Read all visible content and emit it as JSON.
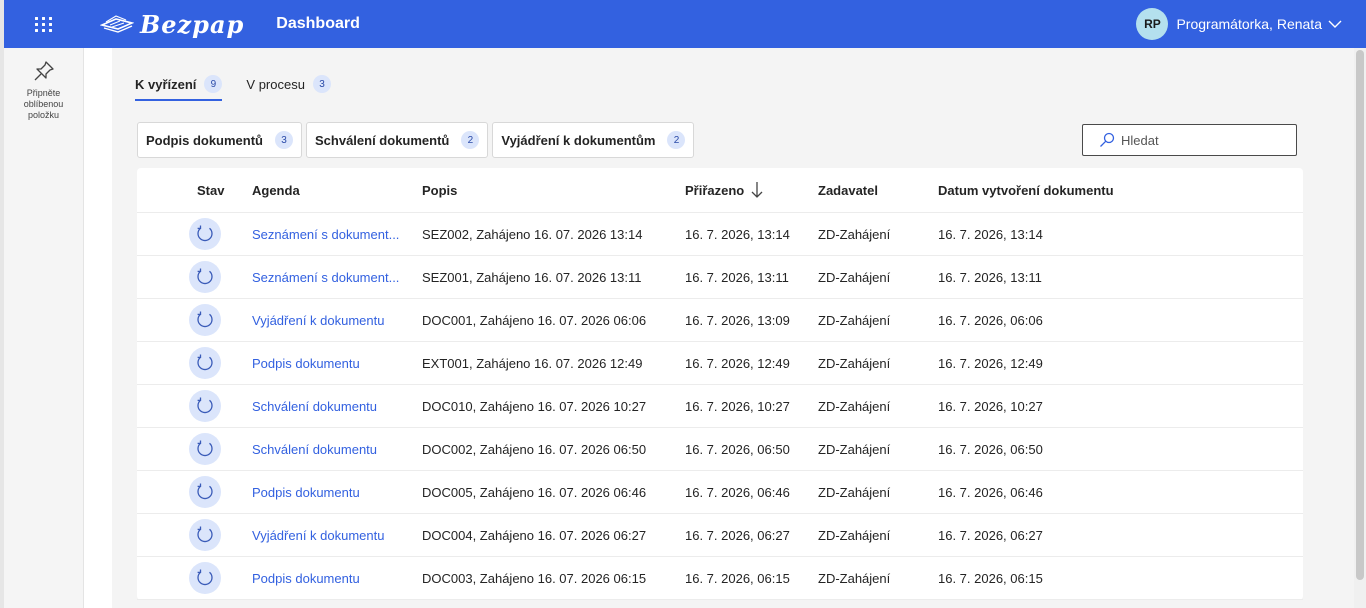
{
  "header": {
    "logo_text": "Bezpap",
    "title": "Dashboard",
    "user": {
      "initials": "RP",
      "name": "Programátorka, Renata"
    },
    "brand_color": "#3361e0"
  },
  "sidebar": {
    "pin_label": "Připněte oblíbenou položku"
  },
  "tabs": [
    {
      "label": "K vyřízení",
      "count": "9",
      "active": true
    },
    {
      "label": "V procesu",
      "count": "3",
      "active": false
    }
  ],
  "filters": [
    {
      "label": "Podpis dokumentů",
      "count": "3"
    },
    {
      "label": "Schválení dokumentů",
      "count": "2"
    },
    {
      "label": "Vyjádření k dokumentům",
      "count": "2"
    }
  ],
  "search": {
    "placeholder": "Hledat"
  },
  "table": {
    "headers": {
      "stav": "Stav",
      "agenda": "Agenda",
      "popis": "Popis",
      "prirazeno": "Přiřazeno",
      "zadavatel": "Zadavatel",
      "datum": "Datum vytvoření dokumentu"
    },
    "sort": {
      "column": "prirazeno",
      "direction": "descending"
    },
    "rows": [
      {
        "agenda": "Seznámení s dokument...",
        "popis": "SEZ002, Zahájeno 16. 07. 2026 13:14",
        "prirazeno": "16. 7. 2026, 13:14",
        "zadavatel": "ZD-Zahájení",
        "datum": "16. 7. 2026, 13:14"
      },
      {
        "agenda": "Seznámení s dokument...",
        "popis": "SEZ001, Zahájeno 16. 07. 2026 13:11",
        "prirazeno": "16. 7. 2026, 13:11",
        "zadavatel": "ZD-Zahájení",
        "datum": "16. 7. 2026, 13:11"
      },
      {
        "agenda": "Vyjádření k dokumentu",
        "popis": "DOC001, Zahájeno 16. 07. 2026 06:06",
        "prirazeno": "16. 7. 2026, 13:09",
        "zadavatel": "ZD-Zahájení",
        "datum": "16. 7. 2026, 06:06"
      },
      {
        "agenda": "Podpis dokumentu",
        "popis": "EXT001, Zahájeno 16. 07. 2026 12:49",
        "prirazeno": "16. 7. 2026, 12:49",
        "zadavatel": "ZD-Zahájení",
        "datum": "16. 7. 2026, 12:49"
      },
      {
        "agenda": "Schválení dokumentu",
        "popis": "DOC010, Zahájeno 16. 07. 2026 10:27",
        "prirazeno": "16. 7. 2026, 10:27",
        "zadavatel": "ZD-Zahájení",
        "datum": "16. 7. 2026, 10:27"
      },
      {
        "agenda": "Schválení dokumentu",
        "popis": "DOC002, Zahájeno 16. 07. 2026 06:50",
        "prirazeno": "16. 7. 2026, 06:50",
        "zadavatel": "ZD-Zahájení",
        "datum": "16. 7. 2026, 06:50"
      },
      {
        "agenda": "Podpis dokumentu",
        "popis": "DOC005, Zahájeno 16. 07. 2026 06:46",
        "prirazeno": "16. 7. 2026, 06:46",
        "zadavatel": "ZD-Zahájení",
        "datum": "16. 7. 2026, 06:46"
      },
      {
        "agenda": "Vyjádření k dokumentu",
        "popis": "DOC004, Zahájeno 16. 07. 2026 06:27",
        "prirazeno": "16. 7. 2026, 06:27",
        "zadavatel": "ZD-Zahájení",
        "datum": "16. 7. 2026, 06:27"
      },
      {
        "agenda": "Podpis dokumentu",
        "popis": "DOC003, Zahájeno 16. 07. 2026 06:15",
        "prirazeno": "16. 7. 2026, 06:15",
        "zadavatel": "ZD-Zahájení",
        "datum": "16. 7. 2026, 06:15"
      }
    ]
  }
}
